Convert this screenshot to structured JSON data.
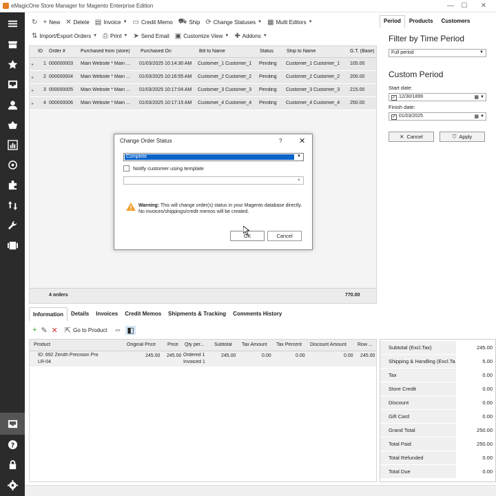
{
  "window": {
    "title": "eMagicOne Store Manager for Magento Enterprise Edition",
    "controls": [
      "—",
      "☐",
      "✕"
    ]
  },
  "toolbar": {
    "row1": [
      {
        "icon": "refresh-icon",
        "glyph": "↻",
        "label": ""
      },
      {
        "icon": "add-icon",
        "glyph": "+",
        "label": "New"
      },
      {
        "icon": "delete-icon",
        "glyph": "✕",
        "label": "Delete"
      },
      {
        "icon": "invoice-icon",
        "glyph": "▤",
        "label": "Invoice",
        "dropdown": true
      },
      {
        "icon": "credit-memo-icon",
        "glyph": "▭",
        "label": "Credit Memo"
      },
      {
        "icon": "ship-icon",
        "glyph": "⛟",
        "label": "Ship"
      },
      {
        "icon": "change-status-icon",
        "glyph": "⟳",
        "label": "Change Statuses",
        "dropdown": true
      },
      {
        "icon": "multi-editor-icon",
        "glyph": "▦",
        "label": "Multi Editors",
        "dropdown": true
      }
    ],
    "row2": [
      {
        "icon": "import-export-icon",
        "glyph": "⇅",
        "label": "Import/Export Orders",
        "dropdown": true
      },
      {
        "icon": "print-icon",
        "glyph": "⎙",
        "label": "Print",
        "dropdown": true
      },
      {
        "icon": "send-email-icon",
        "glyph": "➤",
        "label": "Send Email"
      },
      {
        "icon": "customize-view-icon",
        "glyph": "▣",
        "label": "Customize View",
        "dropdown": true
      },
      {
        "icon": "addons-icon",
        "glyph": "✚",
        "label": "Addons",
        "dropdown": true
      }
    ]
  },
  "orders": {
    "columns": [
      "ID",
      "Order #",
      "Purchased from (store)",
      "Purchased On",
      "Bill to Name",
      "Status",
      "Ship to Name",
      "G.T. (Base)"
    ],
    "rows": [
      {
        "id": "1",
        "order": "000000003",
        "store": "Main Website * Main ...",
        "date": "01/03/2025 10:14:30 AM",
        "bill": "Customer_1 Customer_1",
        "status": "Pending",
        "ship": "Customer_1 Customer_1",
        "gt": "105.00"
      },
      {
        "id": "2",
        "order": "000000004",
        "store": "Main Website * Main ...",
        "date": "01/03/2025 10:16:55 AM",
        "bill": "Customer_2 Customer_2",
        "status": "Pending",
        "ship": "Customer_2 Customer_2",
        "gt": "200.00"
      },
      {
        "id": "3",
        "order": "000000005",
        "store": "Main Website * Main ...",
        "date": "01/03/2025 10:17:04 AM",
        "bill": "Customer_3 Customer_3",
        "status": "Pending",
        "ship": "Customer_3 Customer_3",
        "gt": "215.00"
      },
      {
        "id": "4",
        "order": "000000006",
        "store": "Main Website * Main ...",
        "date": "01/03/2025 10:17:15 AM",
        "bill": "Customer_4 Customer_4",
        "status": "Pending",
        "ship": "Customer_4 Customer_4",
        "gt": "250.00"
      }
    ],
    "footer_count": "4 orders",
    "footer_total": "770.00",
    "status_color": "#f6ef1f"
  },
  "right_panel": {
    "tabs": [
      "Period",
      "Products",
      "Customers"
    ],
    "filter_title": "Filter by Time Period",
    "period_value": "Full period",
    "custom_title": "Custom Period",
    "start_label": "Start date:",
    "start_value": "12/30/1899",
    "finish_label": "Finish date:",
    "finish_value": "01/03/2025",
    "cancel_label": "Cancel",
    "apply_label": "Apply"
  },
  "dialog": {
    "title": "Change Order Status",
    "help": "?",
    "close": "✕",
    "status_value": "Complete",
    "notify_label": "Notify customer using template",
    "warning_bold": "Warning:",
    "warning_text": " This will change order(s) status in your Magento database directly. No invoices/shippings/credit memos will be created.",
    "ok_label": "OK",
    "cancel_label": "Cancel"
  },
  "bottom_tabs": [
    "Information",
    "Details",
    "Invoices",
    "Credit Memos",
    "Shipments & Tracking",
    "Comments History"
  ],
  "bottom_toolbar": {
    "go_to_product": "Go to Product"
  },
  "products": {
    "columns": [
      "Product",
      "Original Price",
      "Price",
      "Qty per...",
      "Subtotal",
      "Tax Amount",
      "Tax Percent",
      "Discount Amount",
      "Row ..."
    ],
    "row": {
      "product_line1": "ID: 692 Zenith Precision Pro",
      "product_line2": "LR-04",
      "original_price": "245.00",
      "price": "245.00",
      "qty_line1": "Ordered 1",
      "qty_line2": "Invoiced 1",
      "subtotal": "245.00",
      "tax_amount": "0.00",
      "tax_percent": "0.00",
      "discount": "0.00",
      "row_total": "245.00"
    }
  },
  "totals": [
    {
      "label": "Subtotal (Excl.Tax)",
      "value": "245.00"
    },
    {
      "label": "Shipping & Handling (Excl.Ta",
      "value": "5.00"
    },
    {
      "label": "Tax",
      "value": "0.00"
    },
    {
      "label": "Store Credit",
      "value": "0.00"
    },
    {
      "label": "Discount",
      "value": "0.00"
    },
    {
      "label": "Gift Card",
      "value": "0.00"
    },
    {
      "label": "Grand Total",
      "value": "250.00"
    },
    {
      "label": "Total Paid",
      "value": "250.00"
    },
    {
      "label": "Total Refunded",
      "value": "0.00"
    },
    {
      "label": "Total Due",
      "value": "0.00"
    }
  ]
}
